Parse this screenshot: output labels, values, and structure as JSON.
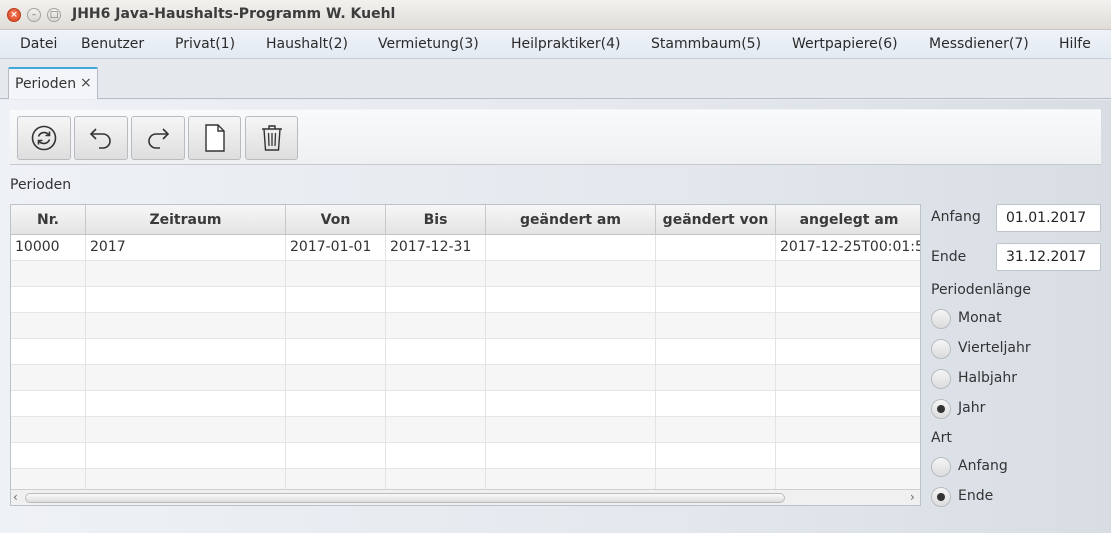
{
  "window": {
    "title": "JHH6 Java-Haushalts-Programm W. Kuehl",
    "close_glyph": "×",
    "min_glyph": "–",
    "max_glyph": "□"
  },
  "menu": [
    "Datei",
    "Benutzer",
    "Privat(1)",
    "Haushalt(2)",
    "Vermietung(3)",
    "Heilpraktiker(4)",
    "Stammbaum(5)",
    "Wertpapiere(6)",
    "Messdiener(7)",
    "Hilfe"
  ],
  "tab": {
    "label": "Perioden",
    "close_glyph": "×"
  },
  "toolbar": {
    "buttons": [
      "refresh-icon",
      "undo-icon",
      "redo-icon",
      "new-document-icon",
      "trash-icon"
    ]
  },
  "section_label": "Perioden",
  "table": {
    "columns": [
      "Nr.",
      "Zeitraum",
      "Von",
      "Bis",
      "geändert am",
      "geändert von",
      "angelegt am"
    ],
    "rows": [
      [
        "10000",
        "2017",
        "2017-01-01",
        "2017-12-31",
        "",
        "",
        "2017-12-25T00:01:5"
      ]
    ],
    "scroll_left_glyph": "‹",
    "scroll_right_glyph": "›"
  },
  "form": {
    "anfang_label": "Anfang",
    "anfang_value": "01.01.2017",
    "ende_label": "Ende",
    "ende_value": "31.12.2017",
    "periodenlaenge_label": "Periodenlänge",
    "periodenlaenge_options": [
      "Monat",
      "Vierteljahr",
      "Halbjahr",
      "Jahr"
    ],
    "periodenlaenge_selected": "Jahr",
    "art_label": "Art",
    "art_options": [
      "Anfang",
      "Ende"
    ],
    "art_selected": "Ende"
  }
}
